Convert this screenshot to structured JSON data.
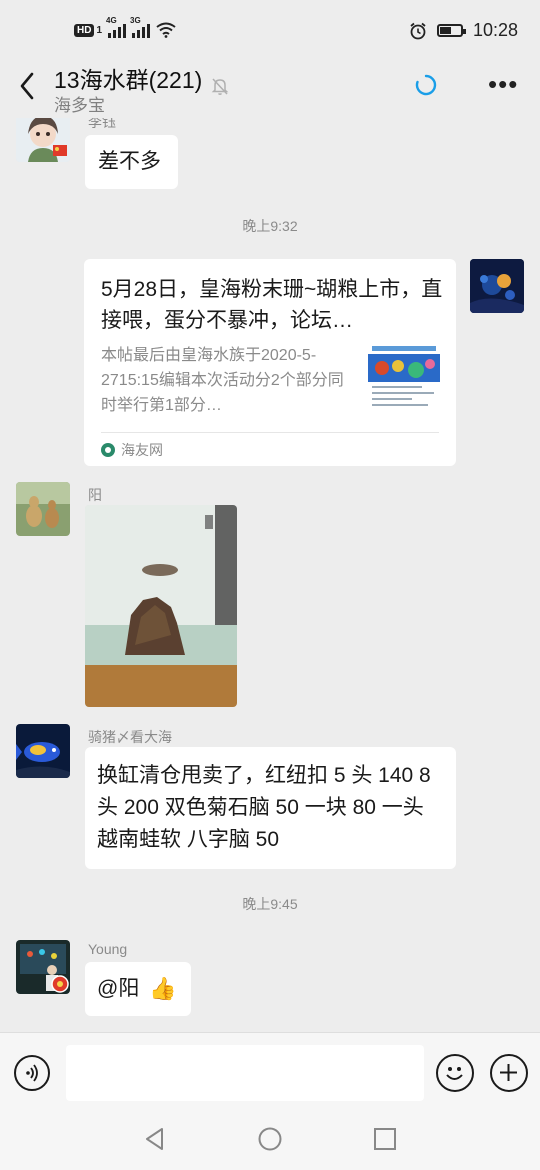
{
  "status_bar": {
    "hd": "HD",
    "hd_sub": "1",
    "net1": "4G",
    "net2": "3G",
    "time": "10:28",
    "battery_level": 0.55
  },
  "header": {
    "title": "13海水群(221)",
    "subtitle": "海多宝"
  },
  "messages": {
    "m1": {
      "sender": "李钰",
      "text": "差不多"
    },
    "time1": "晚上9:32",
    "link": {
      "title": "5月28日，皇海粉末珊~瑚粮上市，直接喂，蛋分不暴冲，论坛…",
      "desc": "本帖最后由皇海水族于2020-5-2715:15编辑本次活动分2个部分同时举行第1部分…",
      "source": "海友网"
    },
    "m2": {
      "sender": "阳"
    },
    "m3": {
      "sender": "骑猪〆看大海",
      "text": "换缸清仓甩卖了，红纽扣 5 头 140 8 头 200 双色菊石脑 50 一块 80 一头 越南蛙软 八字脑 50"
    },
    "time2": "晚上9:45",
    "m4": {
      "sender": "Young",
      "text": "@阳",
      "emoji": "👍"
    }
  },
  "colors": {
    "background": "#ededed",
    "bubble": "#ffffff",
    "accent": "#1a9ee8"
  }
}
